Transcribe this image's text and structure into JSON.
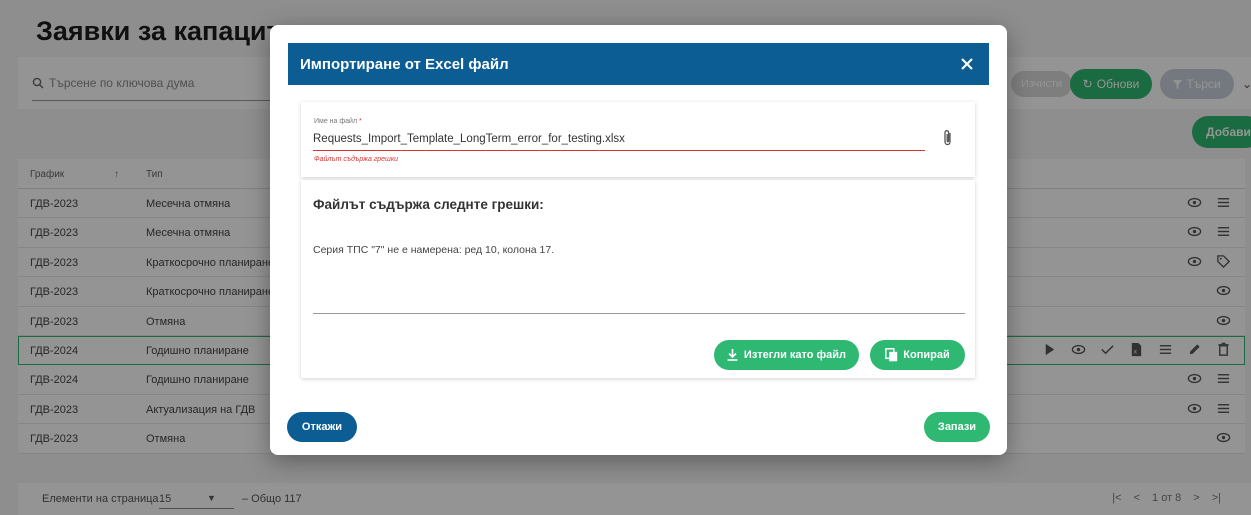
{
  "page": {
    "title": "Заявки за капацитет",
    "search_placeholder": "Търсене по ключова дума",
    "clear_label": "Изчисти",
    "refresh_label": "Обнови",
    "filter_label": "Търси",
    "add_label": "Добави"
  },
  "table": {
    "headers": [
      "График",
      "Тип"
    ],
    "rows": [
      {
        "schedule": "ГДВ-2023",
        "type": "Месечна отмяна",
        "actions": [
          "eye-icon",
          "list-icon"
        ]
      },
      {
        "schedule": "ГДВ-2023",
        "type": "Месечна отмяна",
        "actions": [
          "eye-icon",
          "list-icon"
        ]
      },
      {
        "schedule": "ГДВ-2023",
        "type": "Краткосрочно планиране",
        "actions": [
          "eye-icon",
          "tag-icon"
        ]
      },
      {
        "schedule": "ГДВ-2023",
        "type": "Краткосрочно планиране",
        "actions": [
          "eye-icon"
        ]
      },
      {
        "schedule": "ГДВ-2023",
        "type": "Отмяна",
        "actions": [
          "eye-icon"
        ]
      },
      {
        "schedule": "ГДВ-2024",
        "type": "Годишно планиране",
        "actions": [
          "play-icon",
          "eye-icon",
          "check-icon",
          "file-icon",
          "list-icon",
          "pencil-icon",
          "trash-icon"
        ]
      },
      {
        "schedule": "ГДВ-2024",
        "type": "Годишно планиране",
        "actions": [
          "eye-icon",
          "list-icon"
        ]
      },
      {
        "schedule": "ГДВ-2023",
        "type": "Актуализация на ГДВ",
        "actions": [
          "eye-icon",
          "list-icon"
        ]
      },
      {
        "schedule": "ГДВ-2023",
        "type": "Отмяна",
        "actions": [
          "eye-icon"
        ]
      }
    ]
  },
  "footer": {
    "per_page_label": "Елементи на страница",
    "per_page_value": "15",
    "total": "– Общо 117",
    "page_info": "1 от 8"
  },
  "modal": {
    "title": "Импортиране от Excel файл",
    "file_label": "Име на файл",
    "file_required_mark": "*",
    "file_value": "Requests_Import_Template_LongTerm_error_for_testing.xlsx",
    "file_error": "Файлът съдържа грешки",
    "errors_title": "Файлът съдържа следнте грешки:",
    "errors_text": "Серия ТПС \"7\" не е намерена: ред 10, колона 17.",
    "download_label": "Изтегли като файл",
    "copy_label": "Копирай",
    "cancel_label": "Откажи",
    "save_label": "Запази"
  },
  "colors": {
    "primary_blue": "#0b5d94",
    "accent_green": "#2eb872",
    "error_red": "#dd3333"
  }
}
